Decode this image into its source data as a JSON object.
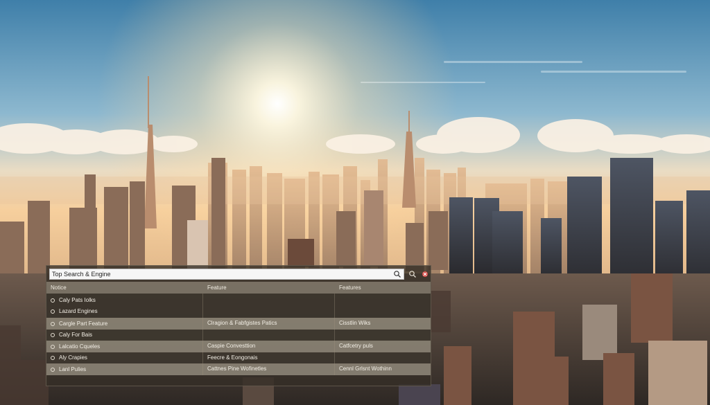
{
  "search": {
    "value": "Top Search & Engine",
    "placeholder": ""
  },
  "toolbar": {
    "search_icon": "search-icon",
    "close_icon": "close-icon"
  },
  "table": {
    "headers": [
      "Notice",
      "Feature",
      "Features"
    ],
    "group1": {
      "items": [
        "Caly Pats Iolks",
        "Lazard Engines"
      ],
      "col2": "",
      "col3": ""
    },
    "rows": [
      {
        "c1": "Cargle Part Feature",
        "c2": "Clragion & Fabfgistes Patics",
        "c3": "Cisstlin Wiks",
        "style": "light"
      },
      {
        "c1": "Caly For Bais",
        "c2": "",
        "c3": "",
        "style": "dark"
      },
      {
        "c1": "Lalcatio Cqueles",
        "c2": "Caspie Convesttion",
        "c3": "Catfcetry puls",
        "style": "light"
      },
      {
        "c1": "Aly Crapies",
        "c2": "Feecre & Eongonais",
        "c3": "",
        "style": "dark"
      },
      {
        "c1": "Lanl Pulies",
        "c2": "Cattnes Pine Wofinetles",
        "c3": "Cennl Grlsnt Wothinn",
        "style": "light"
      }
    ]
  },
  "colors": {
    "sky_top": "#3f7fa9",
    "sun": "#fff4d6",
    "haze": "#f2c893",
    "panel": "#342e26"
  }
}
